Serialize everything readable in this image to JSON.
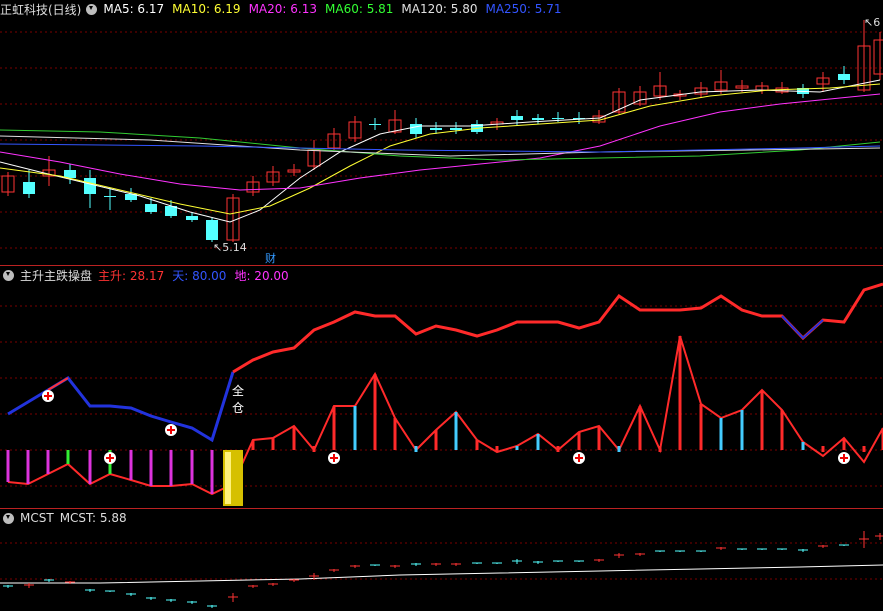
{
  "main_panel": {
    "stock_name": "正虹科技(日线)",
    "indicators": [
      {
        "label": "MA5: 6.17",
        "color": "#ffffff"
      },
      {
        "label": "MA10: 6.19",
        "color": "#ffff33"
      },
      {
        "label": "MA20: 6.13",
        "color": "#ff33ff"
      },
      {
        "label": "MA60: 5.81",
        "color": "#33ff33"
      },
      {
        "label": "MA120: 5.80",
        "color": "#e0e0e0"
      },
      {
        "label": "MA250: 5.71",
        "color": "#3355ff"
      }
    ],
    "low_label": "5.14",
    "high_label": "6",
    "fin_marker": "财"
  },
  "sub_panel": {
    "name": "主升主跌操盘",
    "items": [
      {
        "label": "主升: 28.17",
        "color": "#ff3333"
      },
      {
        "label": "天: 80.00",
        "color": "#3355ff"
      },
      {
        "label": "地: 20.00",
        "color": "#ff33ff"
      }
    ],
    "signal_text_1": "全",
    "signal_text_2": "仓"
  },
  "mcst_panel": {
    "name": "MCST",
    "value_label": "MCST: 5.88"
  },
  "colors": {
    "up": "#ff3333",
    "down": "#54ffff",
    "grid": "#7a0000",
    "separator": "#b22222",
    "ma5": "#ffffff",
    "ma10": "#ffff33",
    "ma20": "#ff33ff",
    "ma60": "#33cc33",
    "ma120": "#e0e0e0",
    "ma250": "#3355ff"
  }
}
